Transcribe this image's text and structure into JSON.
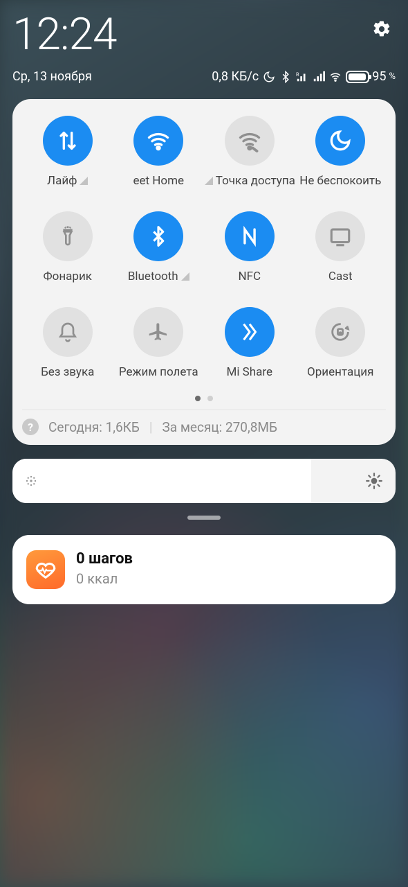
{
  "status": {
    "time": "12:24",
    "date": "Ср, 13 ноября",
    "net_speed": "0,8 КБ/с",
    "battery_pct": "95",
    "battery_suffix": "%"
  },
  "tiles": [
    {
      "id": "mobile-data",
      "label": "Лайф",
      "on": true,
      "signal": true
    },
    {
      "id": "wifi",
      "label": "eet Home",
      "on": true,
      "signal": false
    },
    {
      "id": "hotspot",
      "label": "Точка доступа",
      "on": false,
      "signal": true,
      "signal_before": true
    },
    {
      "id": "dnd",
      "label": "Не беспокоить",
      "on": true,
      "signal": false
    },
    {
      "id": "flashlight",
      "label": "Фонарик",
      "on": false,
      "signal": false
    },
    {
      "id": "bluetooth",
      "label": "Bluetooth",
      "on": true,
      "signal": true
    },
    {
      "id": "nfc",
      "label": "NFC",
      "on": true,
      "signal": false
    },
    {
      "id": "cast",
      "label": "Cast",
      "on": false,
      "signal": false
    },
    {
      "id": "silent",
      "label": "Без звука",
      "on": false,
      "signal": false
    },
    {
      "id": "airplane",
      "label": "Режим полета",
      "on": false,
      "signal": false
    },
    {
      "id": "mishare",
      "label": "Mi Share",
      "on": true,
      "signal": false
    },
    {
      "id": "rotation",
      "label": "Ориентация",
      "on": false,
      "signal": false
    }
  ],
  "usage": {
    "today_label": "Сегодня:",
    "today_value": "1,6КБ",
    "month_label": "За месяц:",
    "month_value": "270,8МБ"
  },
  "notification": {
    "title": "0 шагов",
    "subtitle": "0 ккал"
  }
}
